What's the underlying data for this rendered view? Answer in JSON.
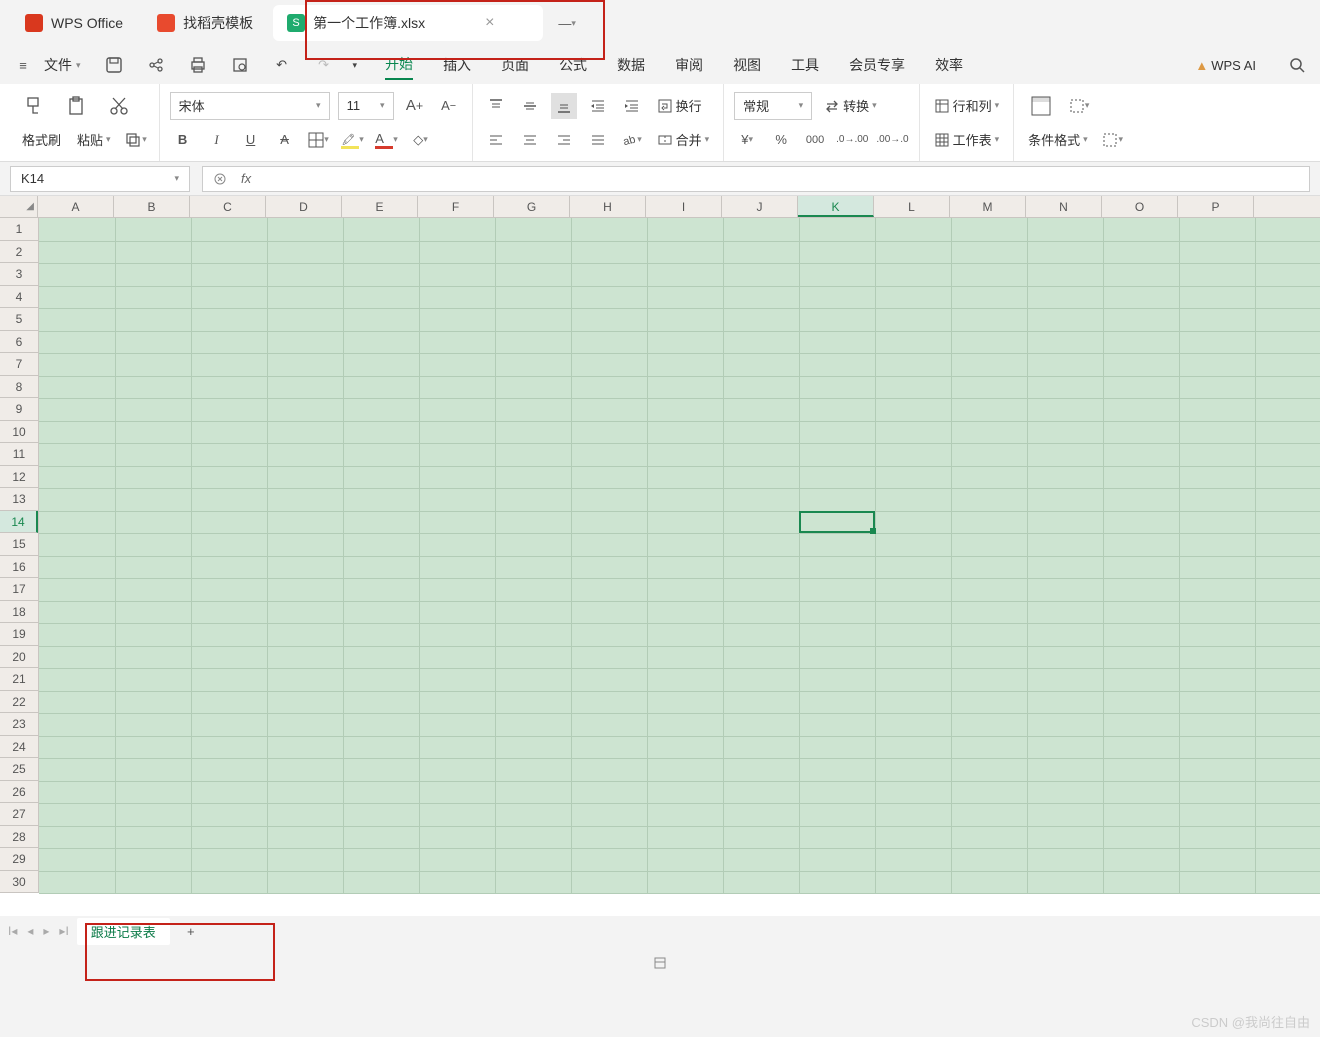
{
  "titlebar": {
    "app_name": "WPS Office",
    "tabs": [
      {
        "label": "找稻壳模板",
        "icon_color": "#e84a2e"
      },
      {
        "label": "第一个工作簿.xlsx",
        "icon_color": "#1fab6e",
        "active": true
      }
    ]
  },
  "menu": {
    "file": "文件",
    "tabs": [
      "开始",
      "插入",
      "页面",
      "公式",
      "数据",
      "审阅",
      "视图",
      "工具",
      "会员专享",
      "效率"
    ],
    "active_tab": "开始",
    "ai_label": "WPS AI"
  },
  "ribbon": {
    "format_painter": "格式刷",
    "paste": "粘贴",
    "font_name": "宋体",
    "font_size": "11",
    "wrap": "换行",
    "merge": "合并",
    "number_format": "常规",
    "convert": "转换",
    "row_col": "行和列",
    "worksheet": "工作表",
    "cond_format": "条件格式"
  },
  "namebox": {
    "value": "K14"
  },
  "formula": {
    "fx": "fx"
  },
  "grid": {
    "columns": [
      "A",
      "B",
      "C",
      "D",
      "E",
      "F",
      "G",
      "H",
      "I",
      "J",
      "K",
      "L",
      "M",
      "N",
      "O",
      "P"
    ],
    "rows": [
      "1",
      "2",
      "3",
      "4",
      "5",
      "6",
      "7",
      "8",
      "9",
      "10",
      "11",
      "12",
      "13",
      "14",
      "15",
      "16",
      "17",
      "18",
      "19",
      "20",
      "21",
      "22",
      "23",
      "24",
      "25",
      "26",
      "27",
      "28",
      "29",
      "30"
    ],
    "selected_col": "K",
    "selected_row": "14"
  },
  "sheets": {
    "active": "跟进记录表"
  },
  "watermark": "CSDN @我尚往自由"
}
